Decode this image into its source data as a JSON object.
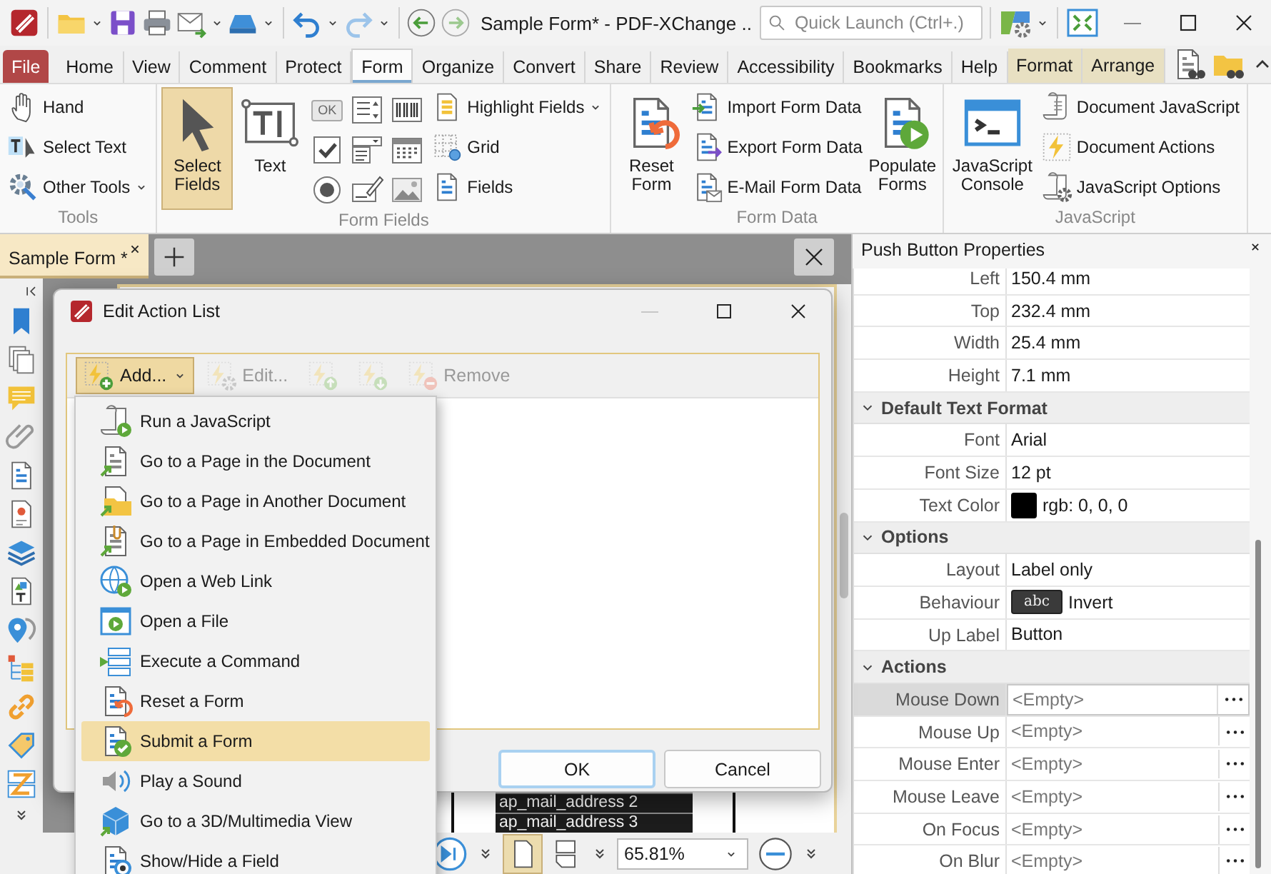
{
  "window": {
    "title": "Sample Form* - PDF-XChange ..",
    "search_placeholder": "Quick Launch (Ctrl+.)"
  },
  "menu_tabs": [
    {
      "label": "File",
      "kind": "file",
      "selected": false
    },
    {
      "label": "Home",
      "kind": "tab",
      "selected": false
    },
    {
      "label": "View",
      "kind": "tab",
      "selected": false
    },
    {
      "label": "Comment",
      "kind": "tab",
      "selected": false
    },
    {
      "label": "Protect",
      "kind": "tab",
      "selected": false
    },
    {
      "label": "Form",
      "kind": "tab",
      "selected": true
    },
    {
      "label": "Organize",
      "kind": "tab",
      "selected": false
    },
    {
      "label": "Convert",
      "kind": "tab",
      "selected": false
    },
    {
      "label": "Share",
      "kind": "tab",
      "selected": false
    },
    {
      "label": "Review",
      "kind": "tab",
      "selected": false
    },
    {
      "label": "Accessibility",
      "kind": "tab",
      "selected": false
    },
    {
      "label": "Bookmarks",
      "kind": "tab",
      "selected": false
    },
    {
      "label": "Help",
      "kind": "tab",
      "selected": false
    },
    {
      "label": "Format",
      "kind": "context",
      "selected": false
    },
    {
      "label": "Arrange",
      "kind": "context",
      "selected": false
    }
  ],
  "ribbon": [
    {
      "title": "Tools",
      "columns": [
        {
          "kind": "stack",
          "items": [
            {
              "label": "Hand",
              "dropdown": false
            },
            {
              "label": "Select Text",
              "dropdown": false
            },
            {
              "label": "Other Tools",
              "dropdown": true
            }
          ]
        }
      ]
    },
    {
      "title": "Form Fields",
      "columns": [
        {
          "kind": "large",
          "label": "Select Fields",
          "selected": true
        },
        {
          "kind": "large",
          "label": "Text",
          "selected": false
        },
        {
          "kind": "grid",
          "button_label": "OK"
        },
        {
          "kind": "stack",
          "items": [
            {
              "label": "Highlight Fields",
              "dropdown": true
            },
            {
              "label": "Grid",
              "dropdown": false
            },
            {
              "label": "Fields",
              "dropdown": false
            }
          ]
        }
      ]
    },
    {
      "title": "Form Data",
      "columns": [
        {
          "kind": "large",
          "label": "Reset Form",
          "selected": false
        },
        {
          "kind": "stack",
          "items": [
            {
              "label": "Import Form Data",
              "dropdown": false
            },
            {
              "label": "Export Form Data",
              "dropdown": false
            },
            {
              "label": "E-Mail Form Data",
              "dropdown": false
            }
          ]
        },
        {
          "kind": "large",
          "label": "Populate Forms",
          "selected": false
        }
      ]
    },
    {
      "title": "JavaScript",
      "columns": [
        {
          "kind": "large",
          "label": "JavaScript Console",
          "selected": false
        },
        {
          "kind": "stack",
          "items": [
            {
              "label": "Document JavaScript",
              "dropdown": false
            },
            {
              "label": "Document Actions",
              "dropdown": false
            },
            {
              "label": "JavaScript Options",
              "dropdown": false
            }
          ]
        }
      ]
    }
  ],
  "document_tab": {
    "title": "Sample Form *"
  },
  "dialog": {
    "title": "Edit Action List",
    "toolbar": [
      {
        "kind": "dropdown",
        "label": "Add...",
        "disabled": false,
        "pressed": true
      },
      {
        "kind": "button",
        "label": "Edit...",
        "disabled": true,
        "pressed": false
      },
      {
        "kind": "up",
        "disabled": true,
        "pressed": false
      },
      {
        "kind": "down",
        "disabled": true,
        "pressed": false
      },
      {
        "kind": "button",
        "label": "Remove",
        "disabled": true,
        "pressed": false
      }
    ],
    "buttons": [
      {
        "label": "OK",
        "default": true
      },
      {
        "label": "Cancel",
        "default": false
      }
    ]
  },
  "action_menu": [
    {
      "label": "Run a JavaScript",
      "selected": false
    },
    {
      "label": "Go to a Page in the Document",
      "selected": false
    },
    {
      "label": "Go to a Page in Another Document",
      "selected": false
    },
    {
      "label": "Go to a Page in Embedded Document",
      "selected": false
    },
    {
      "label": "Open a Web Link",
      "selected": false
    },
    {
      "label": "Open a File",
      "selected": false
    },
    {
      "label": "Execute a Command",
      "selected": false
    },
    {
      "label": "Reset a Form",
      "selected": false
    },
    {
      "label": "Submit a Form",
      "selected": true
    },
    {
      "label": "Play a Sound",
      "selected": false
    },
    {
      "label": "Go to a 3D/Multimedia View",
      "selected": false
    },
    {
      "label": "Show/Hide a Field",
      "selected": false
    }
  ],
  "document": {
    "cells": [
      "ap_mail_address 2",
      "ap_mail_address 3"
    ],
    "zoom": "65.81%"
  },
  "properties": {
    "title": "Push Button Properties",
    "rows": [
      {
        "kind": "field",
        "label": "Left",
        "value": "150.4 mm"
      },
      {
        "kind": "field",
        "label": "Top",
        "value": "232.4 mm"
      },
      {
        "kind": "field",
        "label": "Width",
        "value": "25.4 mm"
      },
      {
        "kind": "field",
        "label": "Height",
        "value": "7.1 mm"
      },
      {
        "kind": "section",
        "label": "Default Text Format",
        "expanded": true
      },
      {
        "kind": "field",
        "label": "Font",
        "value": "Arial"
      },
      {
        "kind": "field",
        "label": "Font Size",
        "value": "12 pt"
      },
      {
        "kind": "color",
        "label": "Text Color",
        "value": "rgb: 0, 0, 0",
        "color": "#000000"
      },
      {
        "kind": "section",
        "label": "Options",
        "expanded": true
      },
      {
        "kind": "field",
        "label": "Layout",
        "value": "Label only"
      },
      {
        "kind": "behaviour",
        "label": "Behaviour",
        "sample": "abc",
        "value": "Invert"
      },
      {
        "kind": "field",
        "label": "Up Label",
        "value": "Button"
      },
      {
        "kind": "section",
        "label": "Actions",
        "expanded": true
      },
      {
        "kind": "action",
        "label": "Mouse Down",
        "value": "<Empty>",
        "selected": true
      },
      {
        "kind": "action",
        "label": "Mouse Up",
        "value": "<Empty>",
        "selected": false
      },
      {
        "kind": "action",
        "label": "Mouse Enter",
        "value": "<Empty>",
        "selected": false
      },
      {
        "kind": "action",
        "label": "Mouse Leave",
        "value": "<Empty>",
        "selected": false
      },
      {
        "kind": "action",
        "label": "On Focus",
        "value": "<Empty>",
        "selected": false
      },
      {
        "kind": "action",
        "label": "On Blur",
        "value": "<Empty>",
        "selected": false
      }
    ]
  }
}
